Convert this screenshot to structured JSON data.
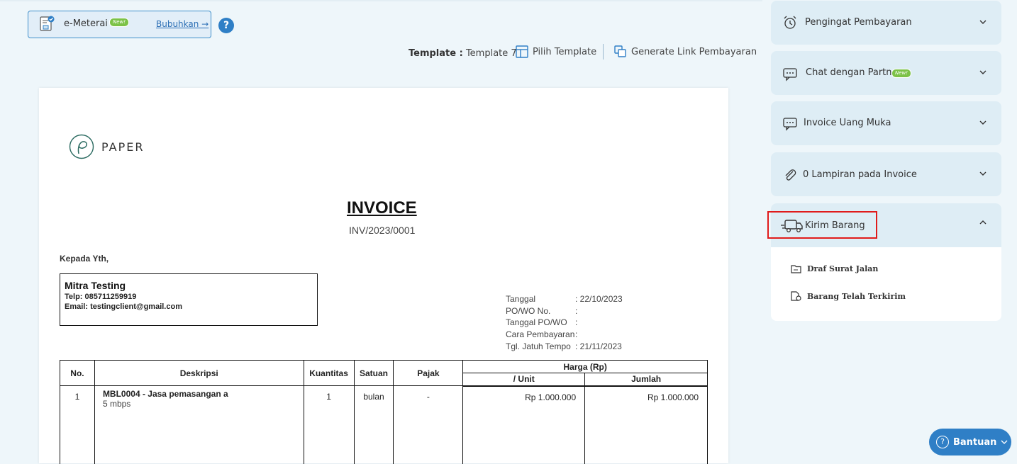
{
  "emeterai": {
    "label": "e-Meterai",
    "badge": "New!",
    "link": "Bubuhkan →"
  },
  "help": "?",
  "template": {
    "prefix": "Template :",
    "name": "Template 7",
    "pick": "Pilih Template",
    "generate": "Generate Link Pembayaran"
  },
  "invoice": {
    "logo_text": "PAPER",
    "title": "INVOICE",
    "number": "INV/2023/0001",
    "kepada": "Kepada Yth,",
    "client": {
      "name": "Mitra Testing",
      "phone": "Telp: 085711259919",
      "email": "Email: testingclient@gmail.com"
    },
    "meta": [
      {
        "k": "Tanggal",
        "v": ": 22/10/2023"
      },
      {
        "k": "PO/WO No.",
        "v": ":"
      },
      {
        "k": "Tanggal PO/WO",
        "v": ":"
      },
      {
        "k": "Cara Pembayaran",
        "v": ":"
      },
      {
        "k": "Tgl. Jatuh Tempo",
        "v": ": 21/11/2023"
      }
    ],
    "table": {
      "h_no": "No.",
      "h_desc": "Deskripsi",
      "h_qty": "Kuantitas",
      "h_unit": "Satuan",
      "h_tax": "Pajak",
      "h_price": "Harga (Rp)",
      "h_per_unit": "/ Unit",
      "h_total": "Jumlah",
      "rows": [
        {
          "no": "1",
          "desc": "MBL0004 - Jasa pemasangan a",
          "desc2": "5 mbps",
          "qty": "1",
          "unit": "bulan",
          "tax": "-",
          "price": "Rp 1.000.000",
          "total": "Rp 1.000.000"
        }
      ]
    }
  },
  "sidebar": {
    "items": [
      {
        "label": "Pengingat Pembayaran",
        "icon": "alarm-clock-icon"
      },
      {
        "label": "Chat dengan Partner",
        "badge": "New!",
        "icon": "chat-icon"
      },
      {
        "label": "Invoice Uang Muka",
        "icon": "message-icon"
      },
      {
        "label": "0 Lampiran pada Invoice",
        "icon": "paperclip-icon"
      }
    ],
    "kirim": {
      "label": "Kirim Barang",
      "icon": "truck-icon",
      "subs": [
        "Draf Surat Jalan",
        "Barang Telah Terkirim"
      ]
    }
  },
  "bantuan": "Bantuan",
  "colors": {
    "accent": "#2f7fc6",
    "highlight": "#e01b1b",
    "badge": "#7cc247"
  }
}
